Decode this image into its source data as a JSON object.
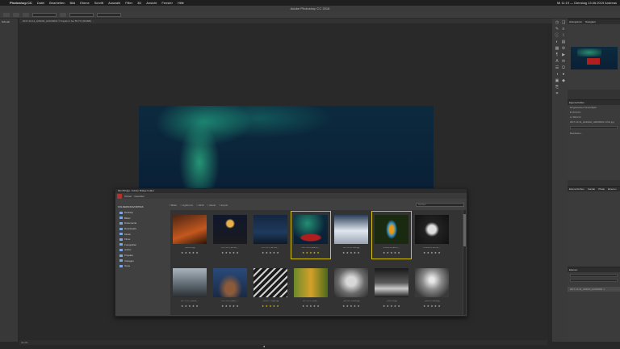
{
  "menubar": {
    "app": "Photoshop CC",
    "items": [
      "Datei",
      "Bearbeiten",
      "Bild",
      "Ebene",
      "Schrift",
      "Auswahl",
      "Filter",
      "3D",
      "Ansicht",
      "Fenster",
      "Hilfe"
    ],
    "status": "Mi 11:19 — Dienstag 13.06.2019  Andreas"
  },
  "window": {
    "title": "Adobe Photoshop CC 2018"
  },
  "doc_tab": {
    "label": "2017-10-14_AINK00_HAK00001 © Kapitel 1 bei 55,7% (RGB/8) ..."
  },
  "toolbar": {
    "label": "Schnell"
  },
  "status_bar": {
    "zoom": "33,3%"
  },
  "dock": {
    "finder_dot": "●"
  },
  "panels": {
    "navigator": {
      "tabs": [
        "Histogramm",
        "Navigator"
      ]
    },
    "properties": {
      "title": "Eigenschaften",
      "subtitle": "Eingebettetes Smartobjekt",
      "fields": [
        "B: 8720 Px",
        "H: 5813 Px"
      ],
      "file": "2017-10-14_HAKHFA_HAK00001 1.Psb.jpg",
      "button": "Bearbeiten..."
    },
    "adjustments": {
      "tabs": [
        "Ebenenfarben",
        "Kanäle",
        "Pfade",
        "Ebenen",
        "Bibliotheken"
      ]
    },
    "layers": {
      "title": "Ebenen",
      "layer_name": "2017-10-14_AINK00_HAK00001 1"
    }
  },
  "bridge": {
    "title": "Mini Bridge / Adobe Bridge Folder",
    "menu": [
      "Ordner",
      "Favoriten"
    ],
    "sidebar_title": "FOLDERS/FAVORITES",
    "sidebar_items": [
      "Desktop",
      "Bilder",
      "Dokumente",
      "Downloads",
      "Musik",
      "Filme",
      "Fotografien",
      "Archiv",
      "Projekte",
      "Vorlagen",
      "Texte"
    ],
    "breadcrumbs": [
      "> Bilder",
      "> Lightroom",
      "> 2018",
      "> Island",
      "> Export"
    ],
    "search_placeholder": "Suchen",
    "thumbs": [
      {
        "caption": "_MG2401.jpg",
        "stars": "★ ★ ★ ★ ★",
        "rated": false
      },
      {
        "caption": "2017-10-11_ALLEN_...",
        "stars": "★ ★ ★ ★ ★",
        "rated": false
      },
      {
        "caption": "2017-10-11_ALLEN_...",
        "stars": "★ ★ ★ ★ ★",
        "rated": false
      },
      {
        "caption": "2017-10-14_AINK00_...",
        "stars": "★ ★ ★ ★ ★",
        "rated": true
      },
      {
        "caption": "2017-10-16 Teich.jpg",
        "stars": "★ ★ ★ ★ ★",
        "rated": false
      },
      {
        "caption": "2018-04-08_AFRO_...",
        "stars": "★ ★ ★ ★ ★",
        "rated": false
      },
      {
        "caption": "2018-06-11_ATOM_...",
        "stars": "★ ★ ★ ★ ★",
        "rated": false
      },
      {
        "caption": "2017-11-01_LEHNE_...",
        "stars": "★ ★ ★ ★ ★",
        "rated": false
      },
      {
        "caption": "2017-10-20_HAKO_...",
        "stars": "★ ★ ★ ★ ★",
        "rated": false
      },
      {
        "caption": "_MG3471 Treppe.jpg",
        "stars": "★ ★ ★ ★ ★",
        "rated": true
      },
      {
        "caption": "2017-10-21_Wald_...",
        "stars": "★ ★ ★ ★ ★",
        "rated": false
      },
      {
        "caption": "_MG4102 Portrait.jpg",
        "stars": "★ ★ ★ ★ ★",
        "rated": false
      },
      {
        "caption": "_MG4130.jpg",
        "stars": "★ ★ ★ ★ ★",
        "rated": false
      },
      {
        "caption": "_MG4201 Mann.jpg",
        "stars": "★ ★ ★ ★ ★",
        "rated": false
      }
    ]
  },
  "colors": {
    "accent": "#d4c20f",
    "bridge_logo": "#b5332e",
    "folder_icon": "#7aa7e0"
  }
}
